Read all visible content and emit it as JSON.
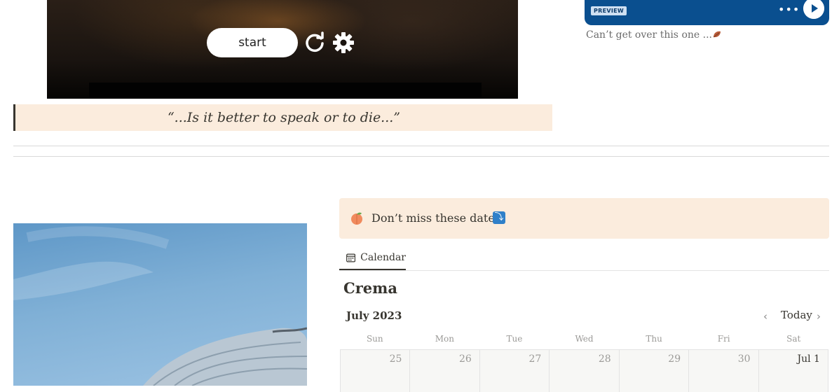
{
  "video": {
    "start_label": "start",
    "reset_icon": "reload-icon",
    "settings_icon": "gear-icon"
  },
  "quote": {
    "text": "“...Is it better to speak or to die...”",
    "background": "#fbecdd"
  },
  "spotify": {
    "badge": "PREVIEW",
    "more_label": "•••",
    "card_color": "#0a4f8f",
    "caption": "Can’t get over this one ...",
    "caption_emoji": "leaf-icon"
  },
  "callout": {
    "emoji": "peach-icon",
    "text": "Don’t miss these dates!",
    "arrow": "⤵",
    "background": "#fbecdd"
  },
  "calendar": {
    "tab_label": "Calendar",
    "title": "Crema",
    "month": "July 2023",
    "today_label": "Today",
    "weekdays": [
      "Sun",
      "Mon",
      "Tue",
      "Wed",
      "Thu",
      "Fri",
      "Sat"
    ],
    "days": [
      "25",
      "26",
      "27",
      "28",
      "29",
      "30",
      "Jul 1"
    ]
  }
}
